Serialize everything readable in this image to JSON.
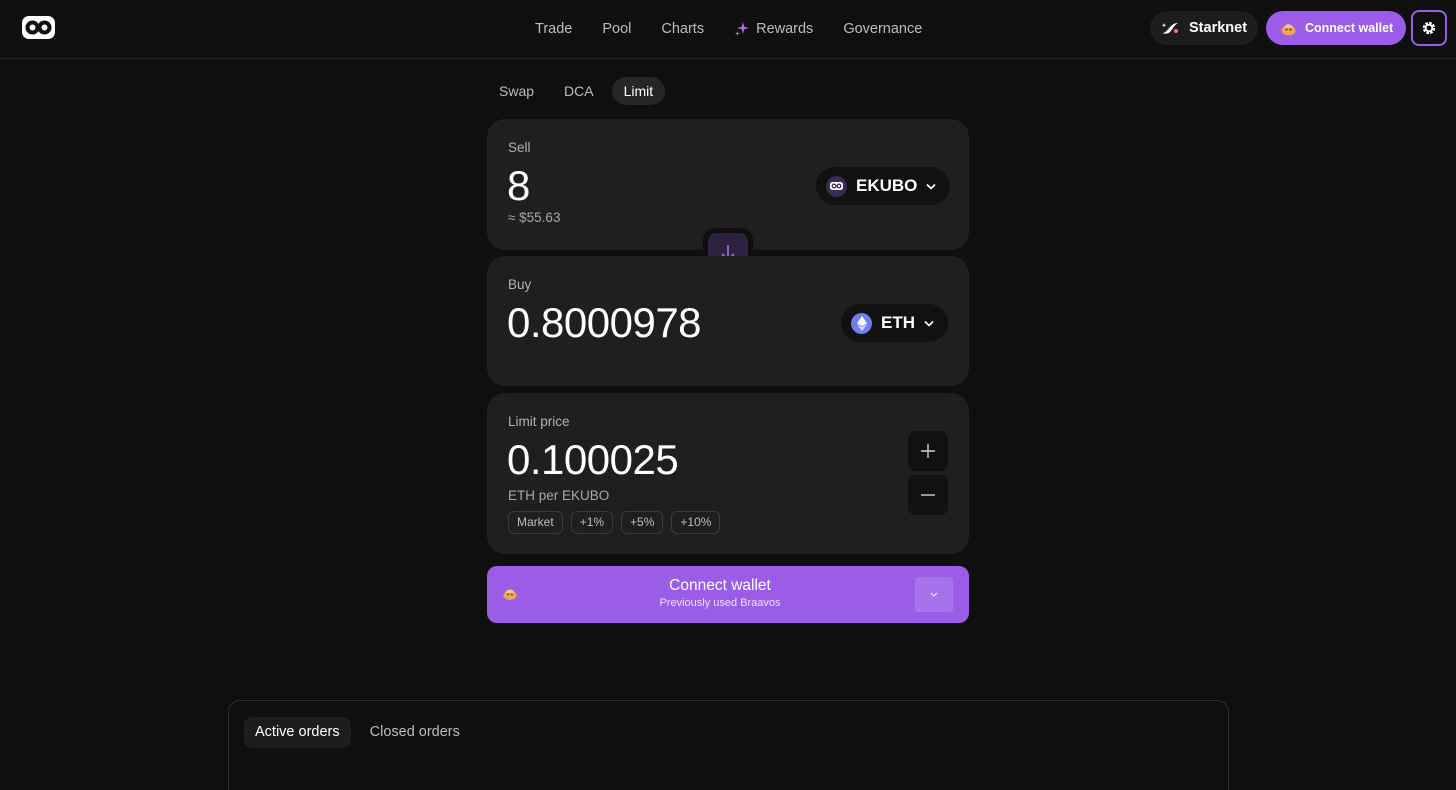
{
  "header": {
    "nav": [
      "Trade",
      "Pool",
      "Charts",
      "Rewards",
      "Governance"
    ],
    "network": "Starknet",
    "connect_label": "Connect wallet"
  },
  "tabs": [
    "Swap",
    "DCA",
    "Limit"
  ],
  "active_tab": "Limit",
  "sell": {
    "label": "Sell",
    "amount": "8",
    "usd": "≈ $55.63",
    "token": "EKUBO"
  },
  "buy": {
    "label": "Buy",
    "amount": "0.8000978",
    "token": "ETH"
  },
  "limit": {
    "label": "Limit price",
    "value": "0.100025",
    "unit": "ETH per EKUBO",
    "chips": [
      "Market",
      "+1%",
      "+5%",
      "+10%"
    ]
  },
  "cta": {
    "title": "Connect wallet",
    "subtitle": "Previously used Braavos"
  },
  "orders": {
    "tabs": [
      "Active orders",
      "Closed orders"
    ],
    "active_tab": "Active orders"
  },
  "colors": {
    "accent": "#9b5de8",
    "background": "#0f0f0f",
    "card": "#1f1f1f"
  },
  "icons": [
    "logo-icon",
    "sparkle-icon",
    "starknet-icon",
    "wallet-icon",
    "gear-icon",
    "ekubo-icon",
    "eth-icon",
    "arrow-down-icon",
    "plus-icon",
    "minus-icon",
    "chevron-down-icon"
  ]
}
